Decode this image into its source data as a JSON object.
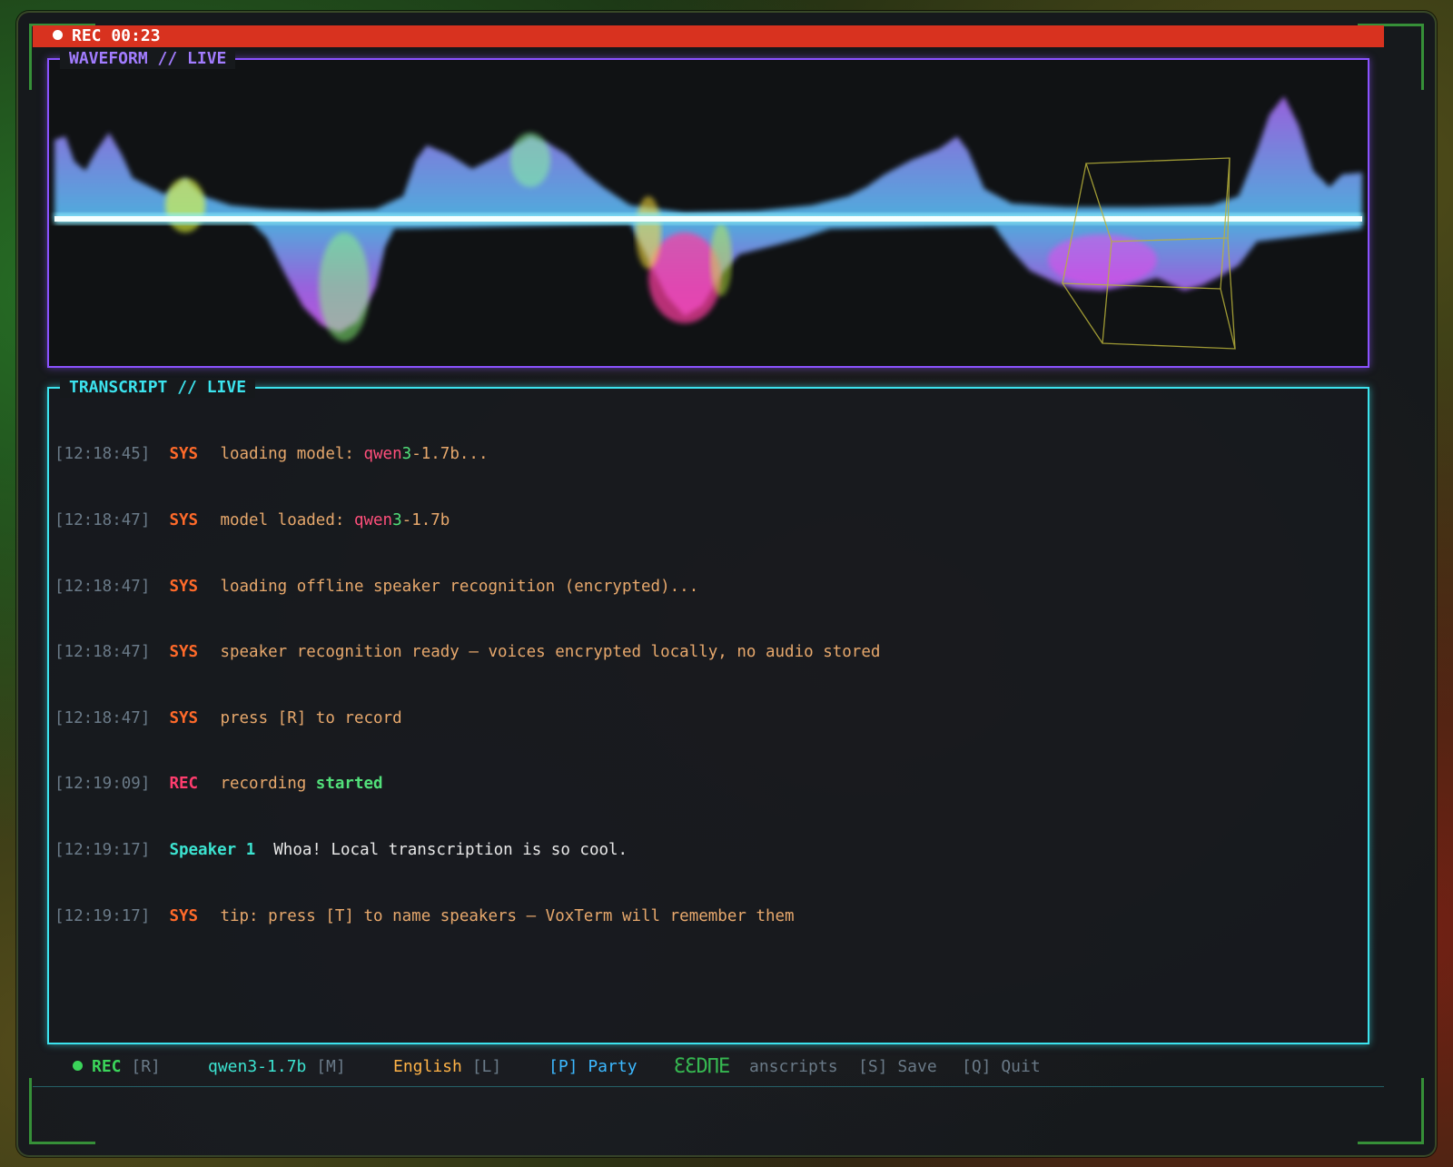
{
  "recbar": {
    "label": "REC 00:23"
  },
  "waveform": {
    "title": "WAVEFORM // LIVE"
  },
  "transcript": {
    "title": "TRANSCRIPT // LIVE",
    "lines": [
      {
        "time": "[12:18:45]",
        "tag": "SYS",
        "parts": [
          "loading model: ",
          "qwen",
          "3",
          "-1.7b",
          "..."
        ]
      },
      {
        "time": "[12:18:47]",
        "tag": "SYS",
        "parts": [
          "model loaded: ",
          "qwen",
          "3",
          "-1.7b",
          ""
        ]
      },
      {
        "time": "[12:18:47]",
        "tag": "SYS",
        "text": "loading offline speaker recognition (encrypted)..."
      },
      {
        "time": "[12:18:47]",
        "tag": "SYS",
        "text": "speaker recognition ready — voices encrypted locally, no audio stored"
      },
      {
        "time": "[12:18:47]",
        "tag": "SYS",
        "text": "press [R] to record"
      },
      {
        "time": "[12:19:09]",
        "tag": "REC",
        "text": "recording ",
        "highlight": "started"
      },
      {
        "time": "[12:19:17]",
        "tag": "Speaker 1",
        "text": "Whoa! Local transcription is so cool."
      },
      {
        "time": "[12:19:17]",
        "tag": "SYS",
        "text": "tip: press [T] to name speakers — VoxTerm will remember them"
      }
    ]
  },
  "statusbar": {
    "rec_label": "REC",
    "rec_key": "[R]",
    "model": "qwen3-1.7b",
    "model_key": "[M]",
    "language": "English",
    "language_key": "[L]",
    "party": "[P] Party",
    "transcripts_visible": "anscripts",
    "glitch": "ƐƐDΠE",
    "save": "[S] Save",
    "quit": "[Q] Quit"
  }
}
